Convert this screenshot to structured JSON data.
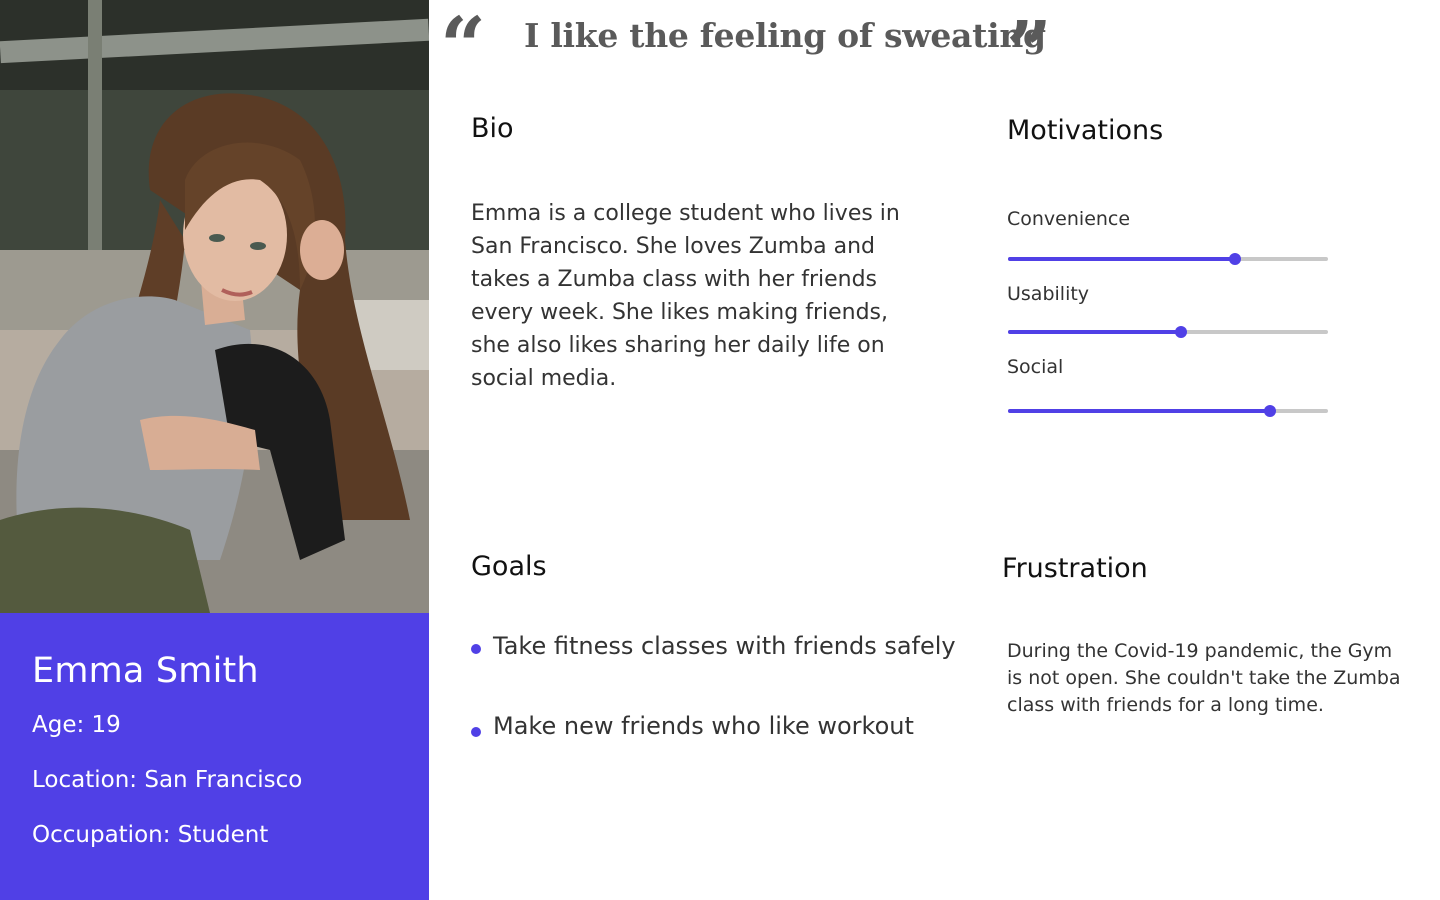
{
  "persona": {
    "name": "Emma Smith",
    "age": "Age: 19",
    "location": "Location: San Francisco",
    "occupation": "Occupation: Student"
  },
  "quote": {
    "text": "I like the feeling of sweating"
  },
  "bio": {
    "heading": "Bio",
    "text": "Emma is a college student who lives in San Francisco. She loves Zumba and takes a Zumba class with her friends every week. She likes making friends, she also likes sharing her daily life on social media."
  },
  "motivations": {
    "heading": "Motivations",
    "items": [
      {
        "label": "Convenience",
        "level_percent": 71
      },
      {
        "label": "Usability",
        "level_percent": 54
      },
      {
        "label": "Social",
        "level_percent": 82
      }
    ]
  },
  "goals": {
    "heading": "Goals",
    "items": [
      "Take fitness classes with friends safely",
      "Make new friends who like workout"
    ]
  },
  "frustration": {
    "heading": "Frustration",
    "text": "During the Covid-19 pandemic, the Gym is not open. She couldn't take the Zumba class with friends for a long time."
  },
  "colors": {
    "accent": "#5040e6",
    "track": "#c8c8c8",
    "quote": "#5a5a5a"
  }
}
